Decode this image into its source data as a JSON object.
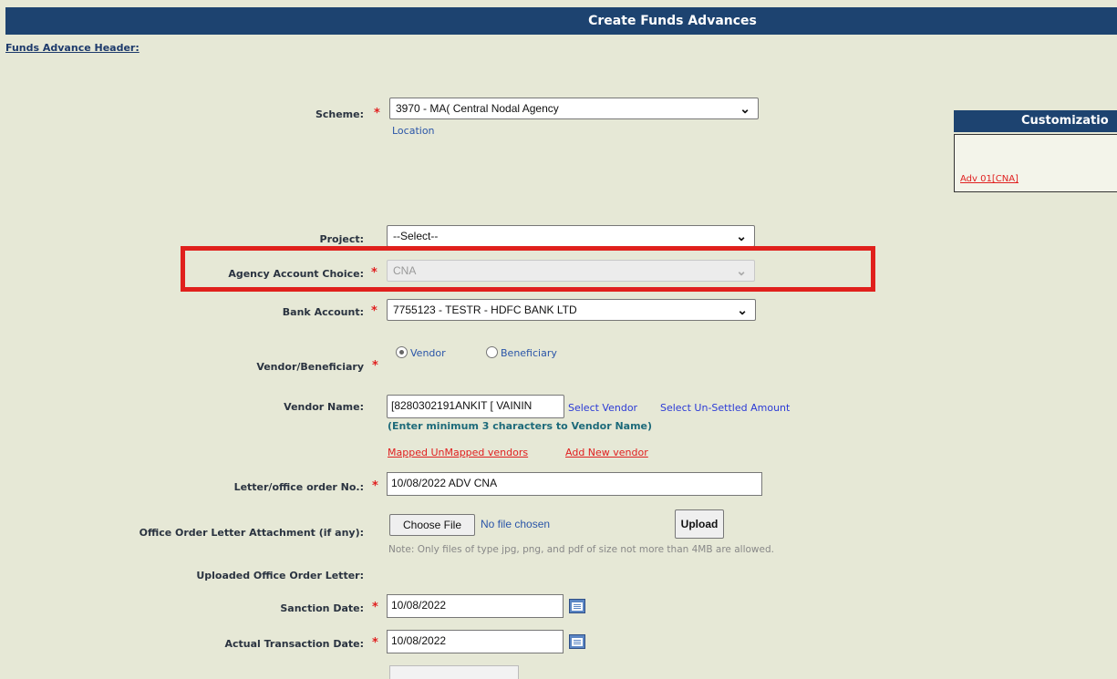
{
  "header": {
    "title": "Create Funds Advances"
  },
  "section": {
    "title": "Funds Advance Header:"
  },
  "fields": {
    "scheme": {
      "label": "Scheme:",
      "value": "3970 - MA( Central Nodal Agency",
      "sub_label": "Location"
    },
    "project": {
      "label": "Project:",
      "value": "--Select--"
    },
    "agency_account_choice": {
      "label": "Agency Account Choice:",
      "value": "CNA"
    },
    "bank_account": {
      "label": "Bank Account:",
      "value": "7755123 - TESTR - HDFC BANK LTD"
    },
    "vendor_beneficiary": {
      "label": "Vendor/Beneficiary",
      "options": [
        "Vendor",
        "Beneficiary"
      ],
      "selected": "Vendor"
    },
    "vendor_name": {
      "label": "Vendor Name:",
      "value": "[8280302191ANKIT [ VAININ",
      "select_vendor": "Select Vendor",
      "select_unsettled": "Select Un-Settled Amount",
      "hint": "(Enter minimum 3 characters to Vendor Name)",
      "mapped_link": "Mapped UnMapped vendors",
      "add_new_link": "Add New vendor"
    },
    "letter_order": {
      "label": "Letter/office order No.:",
      "value": "10/08/2022 ADV CNA"
    },
    "attachment": {
      "label": "Office Order Letter Attachment (if any):",
      "choose_file": "Choose File",
      "no_file": "No file chosen",
      "upload": "Upload",
      "note": "Note: Only files of type jpg, png, and pdf of size not more than 4MB are allowed."
    },
    "uploaded_letter": {
      "label": "Uploaded Office Order Letter:"
    },
    "sanction_date": {
      "label": "Sanction Date:",
      "value": "10/08/2022"
    },
    "actual_transaction_date": {
      "label": "Actual Transaction Date:",
      "value": "10/08/2022"
    }
  },
  "customization": {
    "title": "Customizatio",
    "link": "Adv 01[CNA]"
  },
  "colors": {
    "header_bg": "#1d4370",
    "required": "#e02020",
    "highlight": "#e0201c",
    "page_bg": "#e6e8d6"
  }
}
